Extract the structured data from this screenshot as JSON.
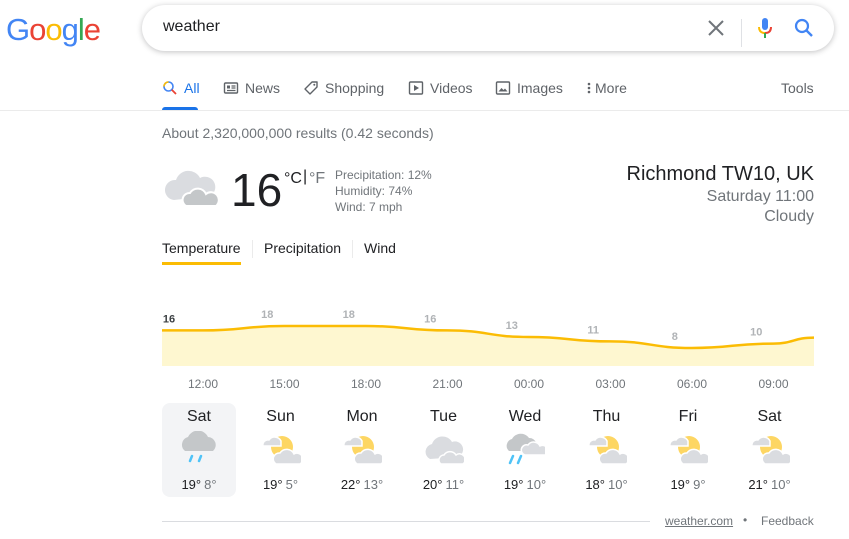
{
  "logo": {
    "letters": [
      "G",
      "o",
      "o",
      "g",
      "l",
      "e"
    ],
    "colors": [
      "#4285f4",
      "#ea4335",
      "#fbbc05",
      "#4285f4",
      "#34a853",
      "#ea4335"
    ]
  },
  "search": {
    "query": "weather",
    "clear_icon": "close-icon",
    "mic_icon": "mic-icon",
    "search_icon": "search-icon"
  },
  "tabs": [
    {
      "label": "All",
      "icon": "search-icon",
      "active": true
    },
    {
      "label": "News",
      "icon": "news-icon"
    },
    {
      "label": "Shopping",
      "icon": "tag-icon"
    },
    {
      "label": "Videos",
      "icon": "play-icon"
    },
    {
      "label": "Images",
      "icon": "image-icon"
    },
    {
      "label": "More",
      "icon": "more-vert-icon"
    }
  ],
  "tools_label": "Tools",
  "result_stats": "About 2,320,000,000 results (0.42 seconds)",
  "weather": {
    "current": {
      "temp": "16",
      "unit_c": "°C",
      "unit_sep": "|",
      "unit_f": "°F",
      "condition_icon": "cloudy-icon",
      "precipitation": "Precipitation: 12%",
      "humidity": "Humidity: 74%",
      "wind": "Wind: 7 mph"
    },
    "location": "Richmond TW10, UK",
    "datetime": "Saturday 11:00",
    "condition": "Cloudy",
    "tabs": [
      "Temperature",
      "Precipitation",
      "Wind"
    ],
    "active_tab": "Temperature",
    "accent": "#fbbc04",
    "forecast": [
      {
        "day": "Sat",
        "hi": "19°",
        "lo": "8°",
        "icon": "rain-cloud-icon",
        "selected": true
      },
      {
        "day": "Sun",
        "hi": "19°",
        "lo": "5°",
        "icon": "partly-cloudy-icon"
      },
      {
        "day": "Mon",
        "hi": "22°",
        "lo": "13°",
        "icon": "partly-cloudy-icon"
      },
      {
        "day": "Tue",
        "hi": "20°",
        "lo": "11°",
        "icon": "cloudy-icon"
      },
      {
        "day": "Wed",
        "hi": "19°",
        "lo": "10°",
        "icon": "showers-icon"
      },
      {
        "day": "Thu",
        "hi": "18°",
        "lo": "10°",
        "icon": "partly-cloudy-icon"
      },
      {
        "day": "Fri",
        "hi": "19°",
        "lo": "9°",
        "icon": "partly-cloudy-icon"
      },
      {
        "day": "Sat",
        "hi": "21°",
        "lo": "10°",
        "icon": "partly-cloudy-icon"
      }
    ],
    "source": "weather.com",
    "separator": "•",
    "feedback": "Feedback"
  },
  "chart_data": {
    "type": "area",
    "title": "Temperature",
    "categories": [
      "12:00",
      "15:00",
      "18:00",
      "21:00",
      "00:00",
      "03:00",
      "06:00",
      "09:00"
    ],
    "values": [
      16,
      18,
      18,
      16,
      13,
      11,
      8,
      10
    ],
    "labels": [
      "16",
      "18",
      "18",
      "16",
      "13",
      "11",
      "8",
      "10"
    ],
    "unit": "°C",
    "ylim": [
      0,
      22
    ],
    "grid": false,
    "xlabel": "",
    "ylabel": ""
  }
}
